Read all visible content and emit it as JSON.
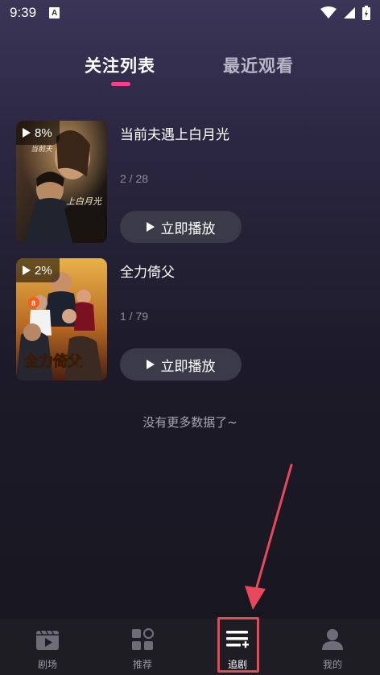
{
  "status": {
    "time": "9:39",
    "notification": "A"
  },
  "tabs": [
    {
      "label": "关注列表"
    },
    {
      "label": "最近观看"
    }
  ],
  "items": [
    {
      "title": "当前夫遇上白月光",
      "progress_badge": "8%",
      "episodes": "2 / 28",
      "play_label": "立即播放",
      "poster_text": "当前夫 ... 上白月光"
    },
    {
      "title": "全力倚父",
      "progress_badge": "2%",
      "episodes": "1 / 79",
      "play_label": "立即播放",
      "poster_text": "全力倚父"
    }
  ],
  "footer_text": "没有更多数据了~",
  "nav": [
    {
      "label": "剧场",
      "icon": "theater-icon"
    },
    {
      "label": "推荐",
      "icon": "grid-icon"
    },
    {
      "label": "追剧",
      "icon": "playlist-add-icon"
    },
    {
      "label": "我的",
      "icon": "profile-icon"
    }
  ],
  "colors": {
    "accent": "#ff3c8a",
    "annotation": "#e8485a"
  }
}
